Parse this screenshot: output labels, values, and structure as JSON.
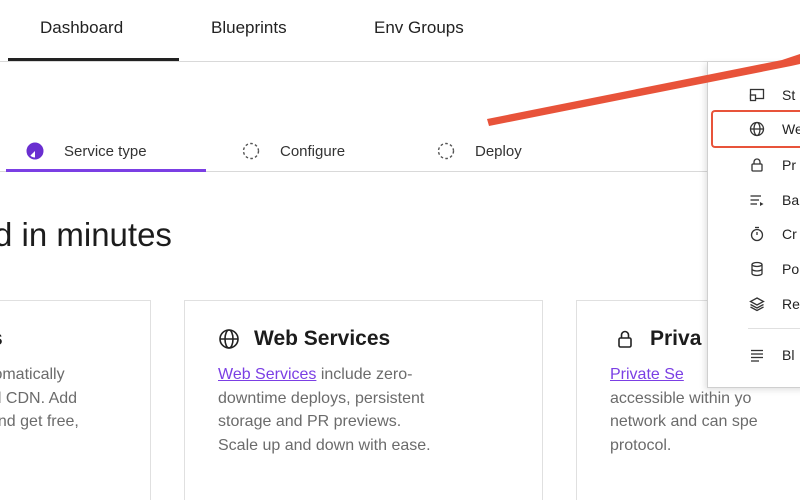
{
  "top_nav": {
    "tabs": [
      "Dashboard",
      "Blueprints",
      "Env Groups"
    ],
    "active": "Dashboard"
  },
  "steps": [
    {
      "label": "Service type",
      "state": "active"
    },
    {
      "label": "Configure",
      "state": "pending"
    },
    {
      "label": "Deploy",
      "state": "pending"
    }
  ],
  "headline": "d in minutes",
  "cards": [
    {
      "title": "s",
      "body": [
        "tomatically",
        "al CDN. Add",
        "and get free,",
        "."
      ]
    },
    {
      "title": "Web Services",
      "link": "Web Services",
      "body_first_rest": " include zero-",
      "body": [
        "downtime deploys, persistent",
        "storage and PR previews.",
        "Scale up and down with ease."
      ]
    },
    {
      "title": "Priva",
      "link": "Private Se",
      "body": [
        "accessible within yo",
        "network and can spe",
        "protocol."
      ]
    }
  ],
  "menu": {
    "items": [
      {
        "label": "St",
        "icon": "static-site-icon"
      },
      {
        "label": "We",
        "icon": "globe-icon",
        "highlighted": true
      },
      {
        "label": "Pr",
        "icon": "lock-icon"
      },
      {
        "label": "Ba",
        "icon": "background-worker-icon"
      },
      {
        "label": "Cr",
        "icon": "stopwatch-icon"
      },
      {
        "label": "Po",
        "icon": "database-icon"
      },
      {
        "label": "Re",
        "icon": "layers-icon"
      },
      {
        "label": "Bl",
        "icon": "list-icon"
      }
    ]
  },
  "colors": {
    "accent": "#7b3fe4",
    "annotation": "#e8533a"
  }
}
